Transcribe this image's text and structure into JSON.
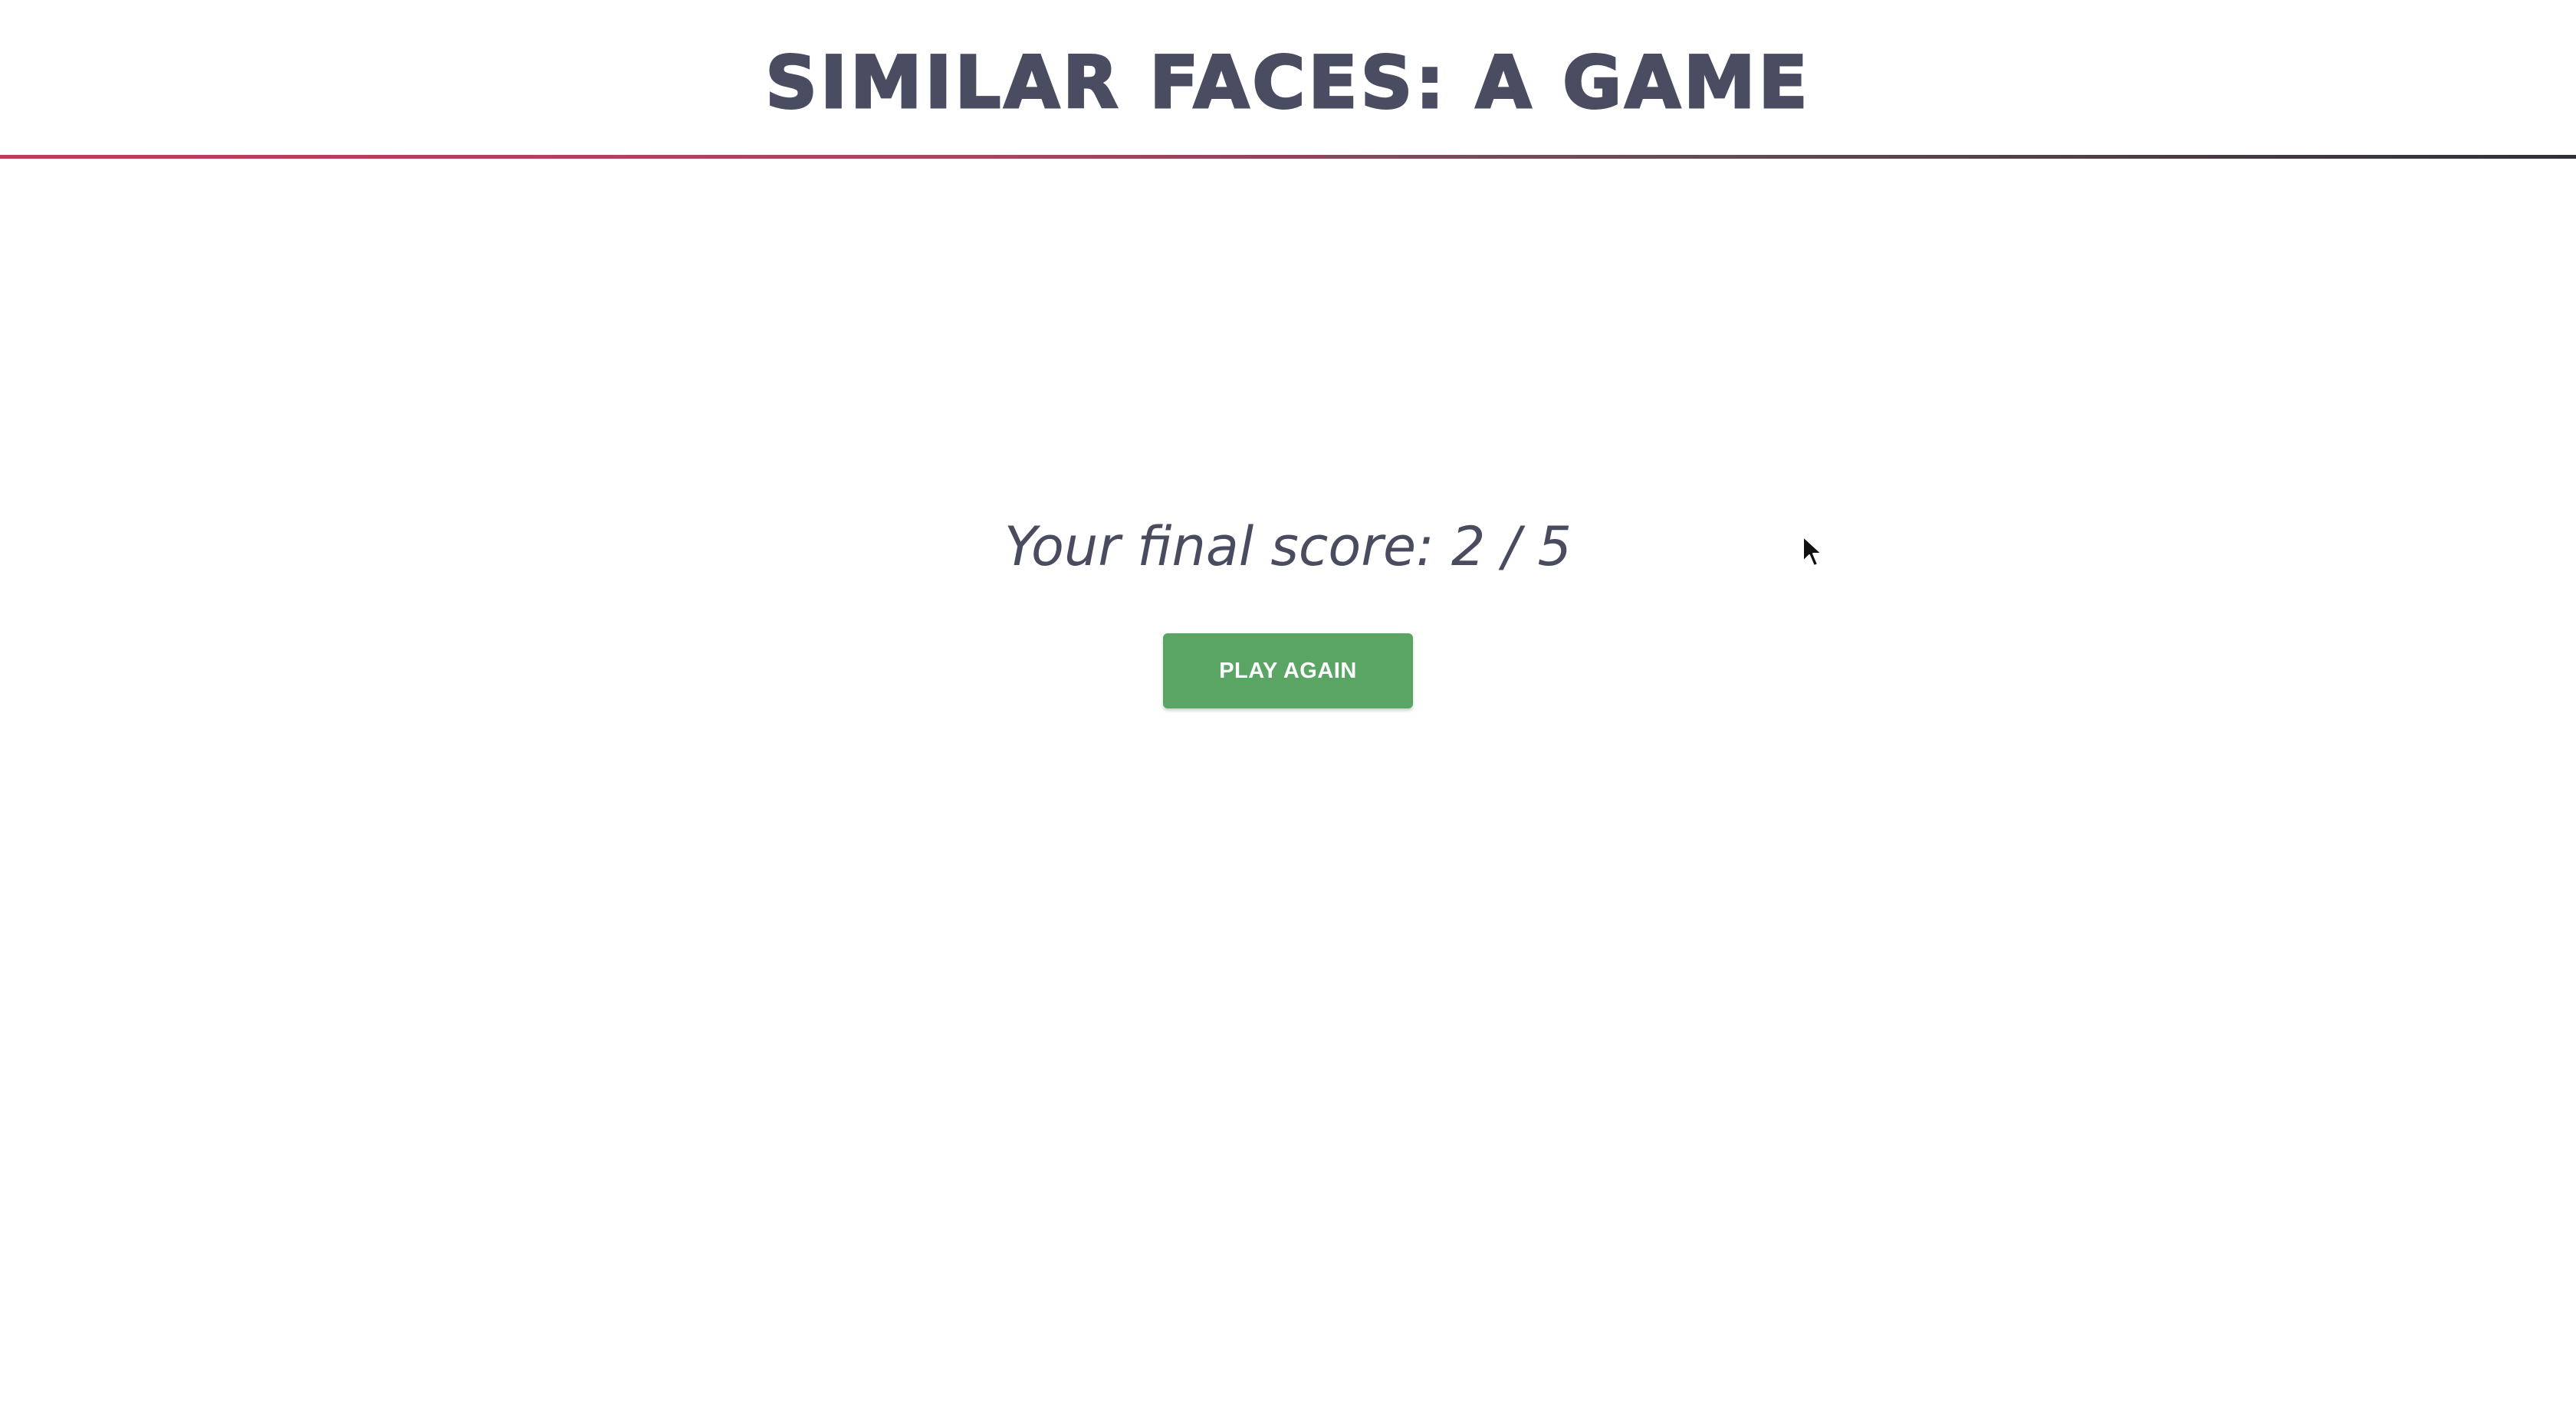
{
  "header": {
    "title": "SIMILAR FACES: A GAME"
  },
  "main": {
    "score_text": "Your final score: 2 / 5",
    "play_again_label": "PLAY AGAIN"
  },
  "colors": {
    "title": "#4a4c61",
    "button": "#5aa564",
    "rule_start": "#c0395a",
    "rule_end": "#2f3038"
  },
  "icons": {
    "cursor": "mouse-pointer-icon"
  }
}
